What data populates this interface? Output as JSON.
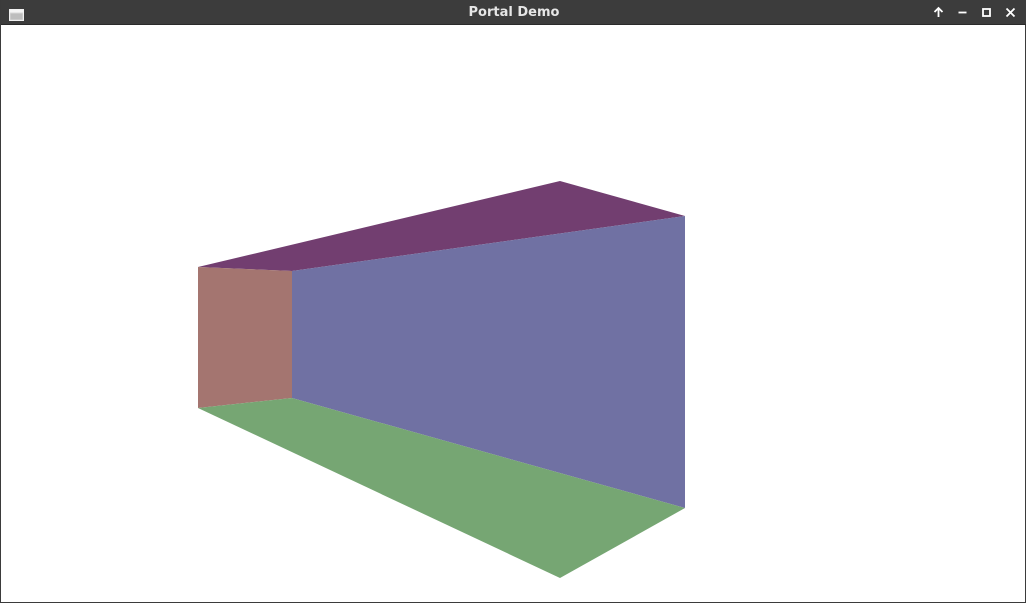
{
  "window": {
    "title": "Portal Demo"
  },
  "icons": {
    "app": "window-icon",
    "keep_above": "arrow-up-icon",
    "minimize": "minimize-icon",
    "maximize": "maximize-icon",
    "close": "close-icon"
  },
  "colors": {
    "titlebar": "#3c3c3c",
    "title_text": "#e6e6e6",
    "ceiling": "#723e70",
    "left_wall": "#a47570",
    "right_wall": "#7071a3",
    "floor": "#76a673",
    "background": "#ffffff"
  }
}
